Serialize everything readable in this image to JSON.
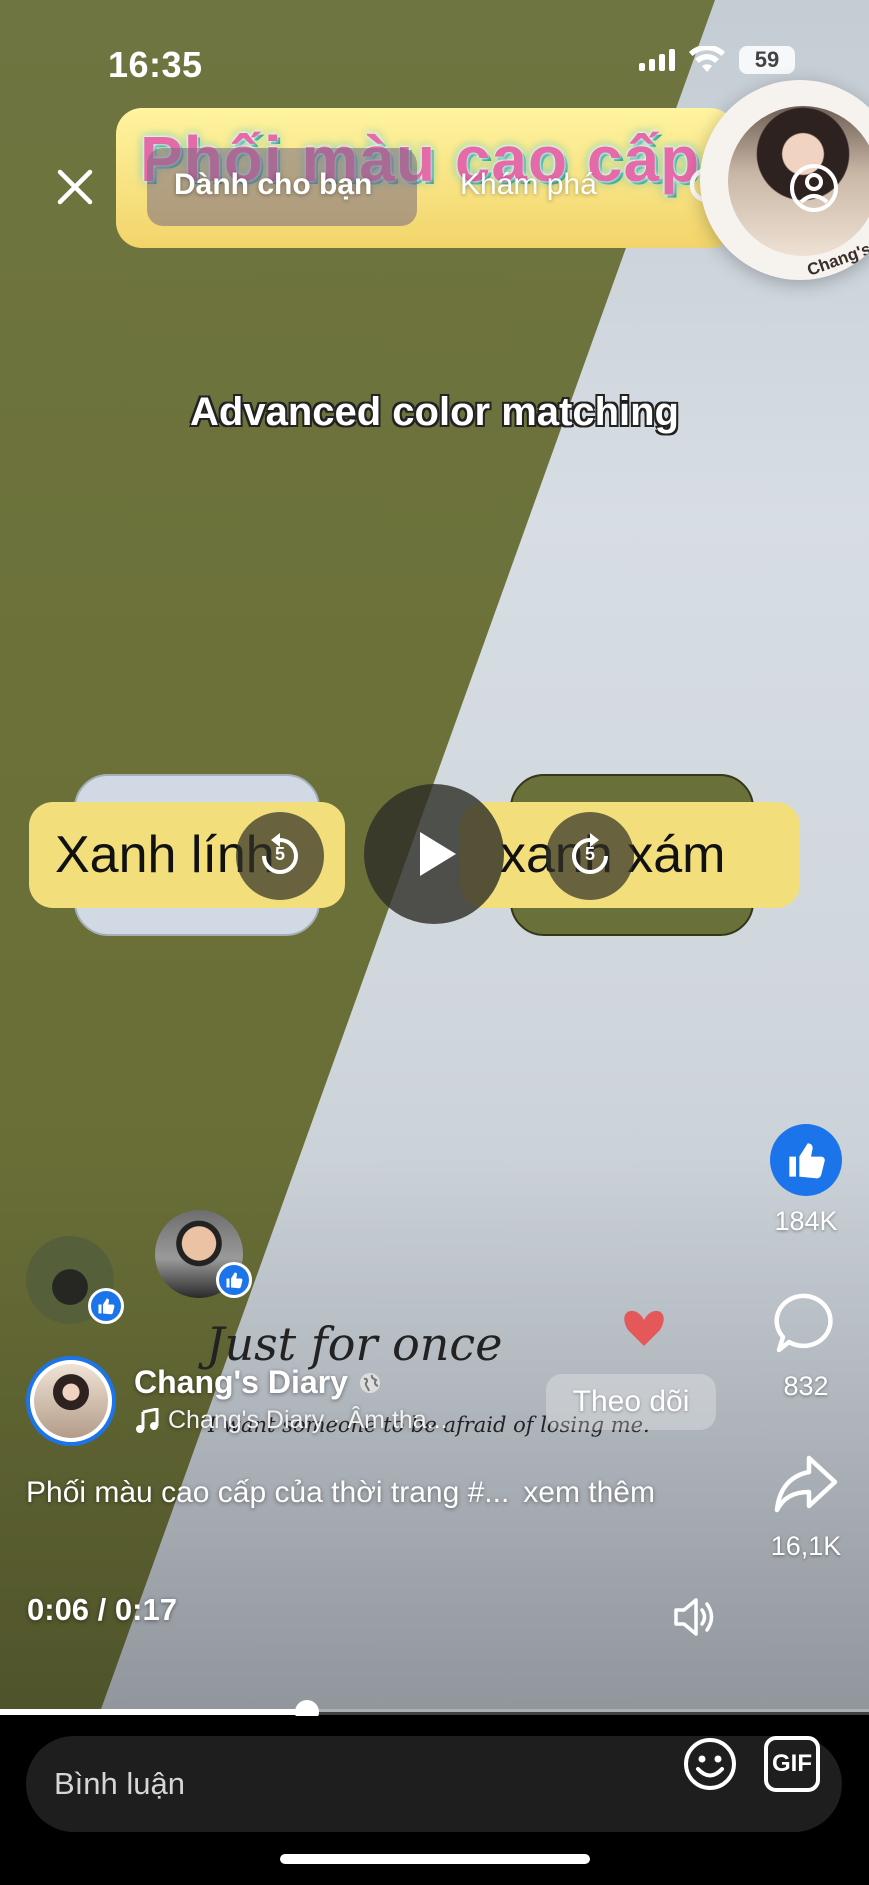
{
  "status_bar": {
    "time": "16:35",
    "battery": "59"
  },
  "header": {
    "tabs": [
      {
        "label": "Dành cho bạn"
      },
      {
        "label": "Khám phá"
      }
    ],
    "close_icon": "close-icon",
    "search_icon": "search-icon",
    "profile_icon": "profile-icon",
    "creator_tag": "Chang's"
  },
  "video": {
    "title_overlay": "Phối màu cao cấp",
    "subtitle": "Advanced color matching",
    "color_labels": [
      "Xanh lính",
      "xanh xám"
    ],
    "replay_seconds": [
      "5",
      "5"
    ],
    "handwriting_title": "Just for once",
    "handwriting_line": "I want someone to be afraid of losing me."
  },
  "actions": {
    "like_count": "184K",
    "comment_count": "832",
    "share_count": "16,1K",
    "accent_color": "#1c74ea"
  },
  "author": {
    "name": "Chang's Diary",
    "audio": "Chang's Diary",
    "audio_suffix": "· Âm tha...",
    "follow_label": "Theo dõi"
  },
  "caption": {
    "text": "Phối màu cao cấp của thời trang  #...",
    "see_more": "xem thêm"
  },
  "playback": {
    "timecode": "0:06 / 0:17",
    "progress_fraction": 0.353
  },
  "comment_bar": {
    "placeholder": "Bình luận",
    "gif_label": "GIF"
  }
}
